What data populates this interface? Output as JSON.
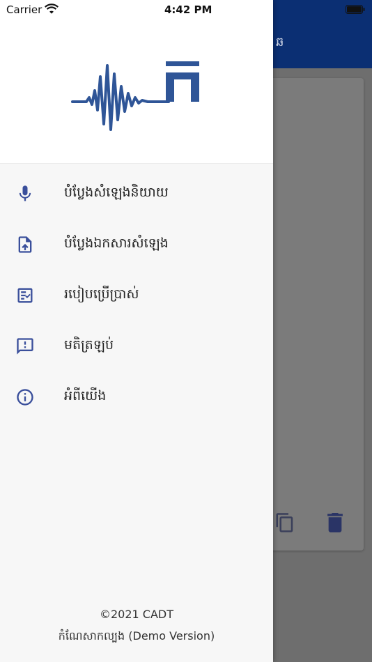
{
  "status_bar": {
    "carrier": "Carrier",
    "time": "4:42 PM"
  },
  "background": {
    "header_title": "ឆ",
    "icons": [
      "copy-icon",
      "delete-icon"
    ]
  },
  "drawer": {
    "menu": [
      {
        "id": "mic",
        "icon": "microphone-icon",
        "label": "បំប្លែងសំឡេងនិយាយ"
      },
      {
        "id": "upload",
        "icon": "file-upload-icon",
        "label": "បំប្លែងឯកសារសំឡេង"
      },
      {
        "id": "guide",
        "icon": "checklist-icon",
        "label": "របៀបប្រើប្រាស់"
      },
      {
        "id": "feedback",
        "icon": "feedback-icon",
        "label": "មតិត្រឡប់"
      },
      {
        "id": "about",
        "icon": "info-icon",
        "label": "អំពីយើង"
      }
    ],
    "footer": {
      "copyright": "©2021 CADT",
      "version": "កំណែសាកល្បង  (Demo Version)"
    }
  },
  "colors": {
    "accent": "#3a4f9b",
    "header_bg": "#0b2f73",
    "logo": "#2f5597"
  }
}
